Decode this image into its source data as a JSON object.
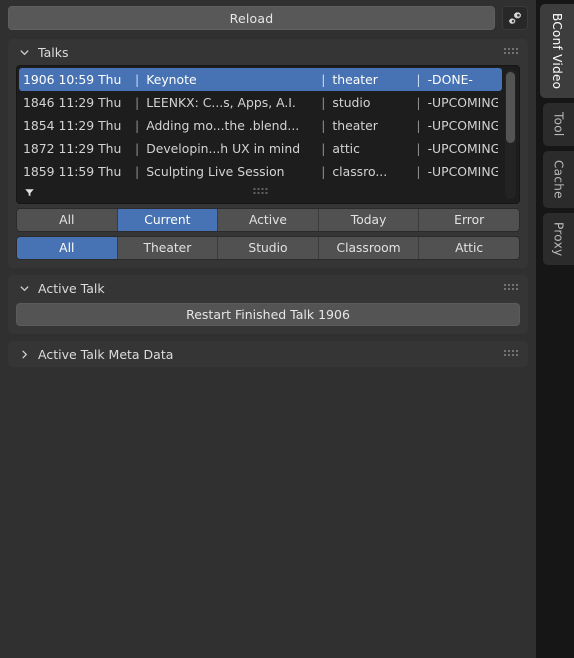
{
  "toolbar": {
    "reload_label": "Reload",
    "settings_icon": "gears-icon"
  },
  "panels": {
    "talks": {
      "title": "Talks",
      "expanded_icon": "chevron-down-icon",
      "grip_icon": "grip-dots-icon",
      "columns": [
        "id_time_day",
        "title",
        "room",
        "status"
      ],
      "rows": [
        {
          "id_time_day": "1906 10:59 Thu",
          "title": "Keynote",
          "room": "theater",
          "status": "-DONE-",
          "selected": true
        },
        {
          "id_time_day": "1846 11:29 Thu",
          "title": "LEENKX: C...s, Apps, A.I.",
          "room": "studio",
          "status": "-UPCOMING-",
          "selected": false
        },
        {
          "id_time_day": "1854 11:29 Thu",
          "title": "Adding mo...the .blend...",
          "room": "theater",
          "status": "-UPCOMING-",
          "selected": false
        },
        {
          "id_time_day": "1872 11:29 Thu",
          "title": "Developin...h UX in mind",
          "room": "attic",
          "status": "-UPCOMING-",
          "selected": false
        },
        {
          "id_time_day": "1859 11:59 Thu",
          "title": "Sculpting Live Session",
          "room": "classro...",
          "status": "-UPCOMING-",
          "selected": false
        }
      ],
      "separator": "|",
      "filter_icon": "funnel-icon",
      "filter_rows": [
        {
          "name": "status-filter",
          "buttons": [
            {
              "label": "All",
              "active": false
            },
            {
              "label": "Current",
              "active": true
            },
            {
              "label": "Active",
              "active": false
            },
            {
              "label": "Today",
              "active": false
            },
            {
              "label": "Error",
              "active": false
            }
          ]
        },
        {
          "name": "room-filter",
          "buttons": [
            {
              "label": "All",
              "active": true
            },
            {
              "label": "Theater",
              "active": false
            },
            {
              "label": "Studio",
              "active": false
            },
            {
              "label": "Classroom",
              "active": false
            },
            {
              "label": "Attic",
              "active": false
            }
          ]
        }
      ]
    },
    "active_talk": {
      "title": "Active Talk",
      "expanded_icon": "chevron-down-icon",
      "grip_icon": "grip-dots-icon",
      "restart_label": "Restart Finished Talk 1906"
    },
    "active_talk_meta": {
      "title": "Active Talk Meta Data",
      "collapsed_icon": "chevron-right-icon",
      "grip_icon": "grip-dots-icon"
    }
  },
  "tabstrip": {
    "tabs": [
      {
        "label": "BConf Video",
        "active": true
      },
      {
        "label": "Tool",
        "active": false
      },
      {
        "label": "Cache",
        "active": false
      },
      {
        "label": "Proxy",
        "active": false
      }
    ]
  },
  "colors": {
    "accent_blue": "#4772b3",
    "panel_bg": "#353535",
    "page_bg": "#303030",
    "list_bg": "#1d1d1d",
    "button_bg": "#545454"
  }
}
